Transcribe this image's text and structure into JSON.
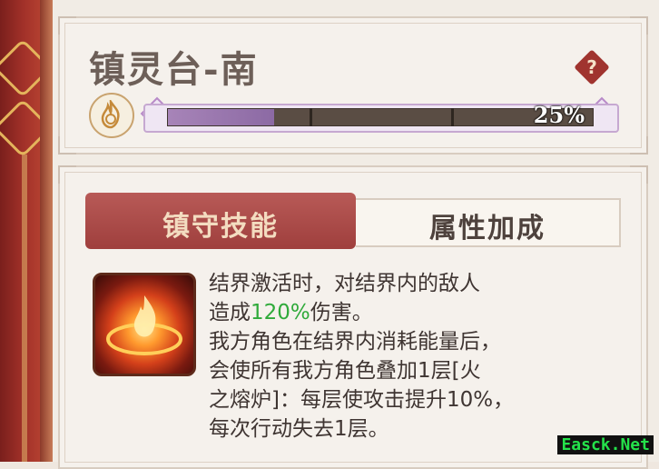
{
  "header": {
    "title": "镇灵台-南",
    "help_symbol": "?",
    "progress_percent": 25,
    "progress_text": "25%"
  },
  "tabs": [
    {
      "label": "镇守技能",
      "active": true
    },
    {
      "label": "属性加成",
      "active": false
    }
  ],
  "skill": {
    "icon": "fire-ring-icon",
    "lines": [
      "结界激活时，对结界内的敌人",
      "造成",
      "120%",
      "伤害。",
      "我方角色在结界内消耗能量后，",
      "会使所有我方角色叠加1层[火",
      "之熔炉]：每层使攻击提升10%，",
      "每次行动失去1层。"
    ]
  },
  "watermark": "Easck.Net",
  "colors": {
    "accent_red": "#a0342f",
    "progress_purple": "#a784b8",
    "highlight_green": "#2faa3a"
  }
}
